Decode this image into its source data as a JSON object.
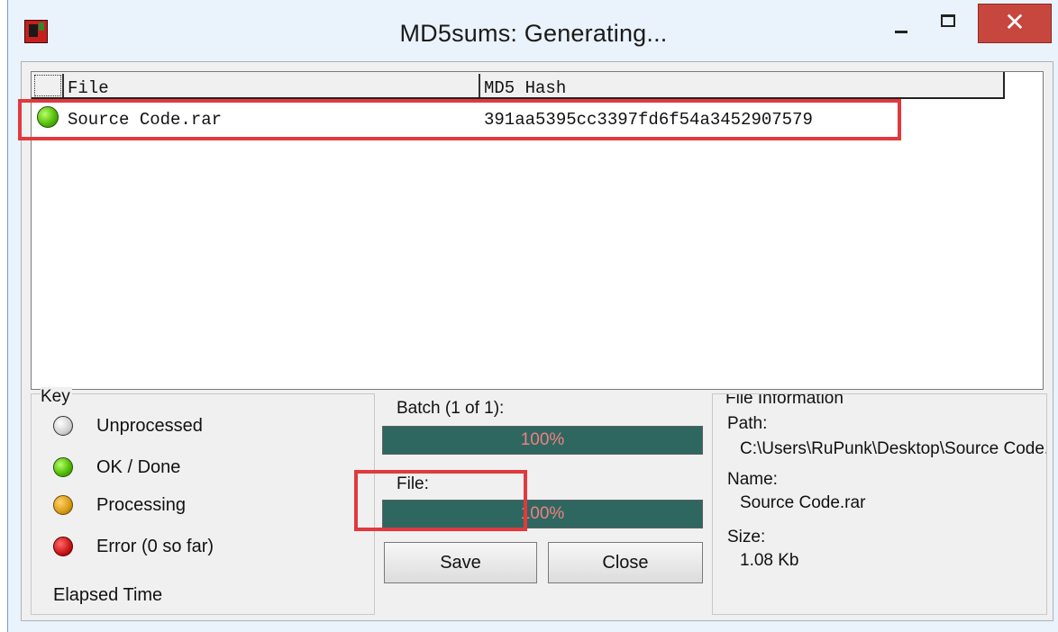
{
  "window": {
    "title": "MD5sums: Generating...",
    "close_glyph": "✕"
  },
  "file_list": {
    "columns": {
      "file": "File",
      "hash": "MD5 Hash"
    },
    "rows": [
      {
        "file": "Source Code.rar",
        "hash": "391aa5395cc3397fd6f54a3452907579",
        "status": "ok"
      }
    ]
  },
  "key": {
    "title": "Key",
    "items": [
      {
        "label": "Unprocessed",
        "icon": "gray-dot-icon"
      },
      {
        "label": "OK / Done",
        "icon": "green-dot-icon"
      },
      {
        "label": "Processing",
        "icon": "orange-dot-icon"
      },
      {
        "label": "Error (0 so far)",
        "icon": "red-dot-icon"
      }
    ],
    "elapsed_label": "Elapsed Time"
  },
  "progress": {
    "batch_label": "Batch (1 of 1):",
    "batch_percent": 100,
    "batch_text": "100%",
    "file_label": "File:",
    "file_percent": 100,
    "file_text": "100%"
  },
  "buttons": {
    "save": "Save",
    "close": "Close"
  },
  "file_info": {
    "title": "File Information",
    "path_label": "Path:",
    "path_value": "C:\\Users\\RuPunk\\Desktop\\Source Code.rar",
    "name_label": "Name:",
    "name_value": "Source Code.rar",
    "size_label": "Size:",
    "size_value": "1.08 Kb"
  },
  "colors": {
    "accent_highlight": "#e0393e",
    "progress_fill": "#2e6760",
    "progress_text": "#f08080",
    "close_button": "#c7463d"
  }
}
